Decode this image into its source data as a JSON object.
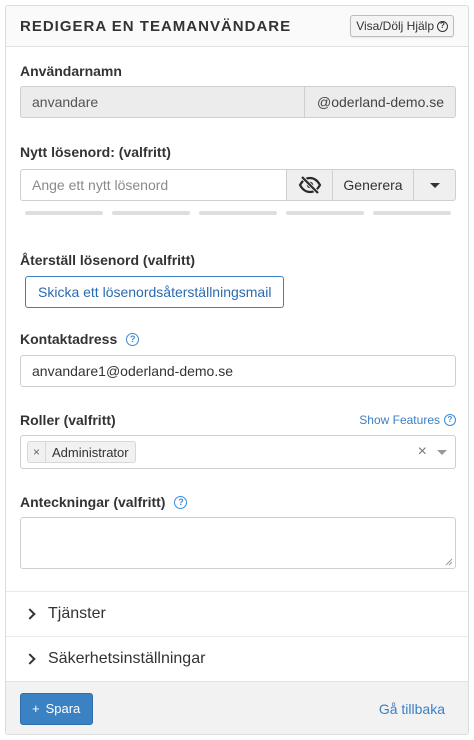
{
  "header": {
    "title": "REDIGERA EN TEAMANVÄNDARE",
    "help_button": "Visa/Dölj Hjälp",
    "help_icon_glyph": "?"
  },
  "username": {
    "label": "Användarnamn",
    "value": "anvandare",
    "domain": "@oderland-demo.se"
  },
  "password": {
    "label": "Nytt lösenord: (valfritt)",
    "placeholder": "Ange ett nytt lösenord",
    "visibility_icon": "eye-slash-icon",
    "generate_label": "Generera",
    "strength_segments": 5
  },
  "reset": {
    "label": "Återställ lösenord (valfritt)",
    "button": "Skicka ett lösenordsåterställningsmail"
  },
  "contact": {
    "label": "Kontaktadress",
    "value": "anvandare1@oderland-demo.se"
  },
  "roles": {
    "label": "Roller (valfritt)",
    "show_features": "Show Features",
    "selected": [
      "Administrator"
    ],
    "tag_remove": "×",
    "clear": "×"
  },
  "notes": {
    "label": "Anteckningar (valfritt)",
    "value": ""
  },
  "sections": [
    {
      "label": "Tjänster"
    },
    {
      "label": "Säkerhetsinställningar"
    }
  ],
  "footer": {
    "save_icon": "+",
    "save_label": "Spara",
    "back_label": "Gå tillbaka"
  },
  "colors": {
    "accent": "#3a82c4",
    "link": "#3b7fc4"
  }
}
